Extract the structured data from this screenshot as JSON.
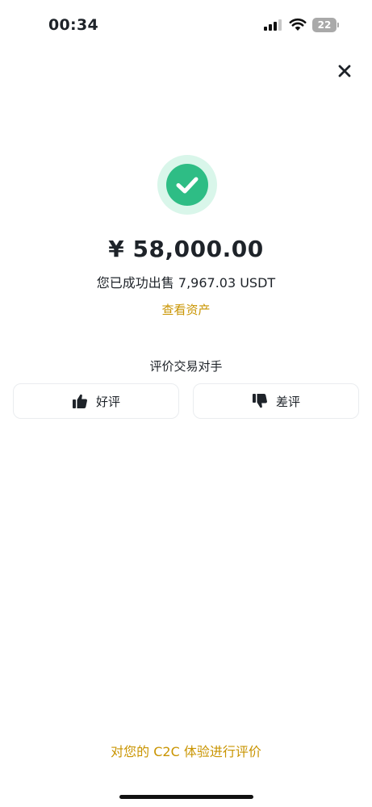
{
  "status_bar": {
    "time": "00:34",
    "battery_level": "22"
  },
  "success": {
    "amount": "¥ 58,000.00",
    "message": "您已成功出售 7,967.03 USDT",
    "view_assets_label": "查看资产"
  },
  "rating": {
    "title": "评价交易对手",
    "good_label": "好评",
    "bad_label": "差评"
  },
  "footer": {
    "c2c_feedback_label": "对您的 C2C 体验进行评价"
  },
  "colors": {
    "success_green": "#2ebd85",
    "accent_gold": "#c99400",
    "text_primary": "#1e2329"
  },
  "icons": {
    "close": "close-icon",
    "success": "check-circle-icon",
    "good": "thumbs-up-icon",
    "bad": "thumbs-down-icon"
  }
}
